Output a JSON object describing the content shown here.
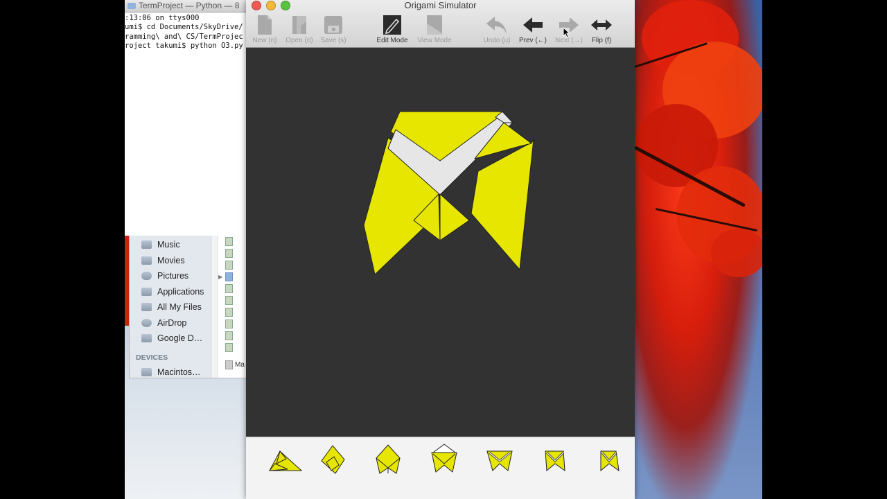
{
  "terminal": {
    "title": "TermProject — Python — 8",
    "lines": [
      ":13:06 on ttys000",
      "umi$ cd Documents/SkyDrive/",
      "ramming\\ and\\ CS/TermProjec",
      "roject takumi$ python O3.py"
    ]
  },
  "finder": {
    "items": [
      {
        "label": "Music",
        "icon": "folder-icon"
      },
      {
        "label": "Movies",
        "icon": "movies-icon"
      },
      {
        "label": "Pictures",
        "icon": "camera-icon"
      },
      {
        "label": "Applications",
        "icon": "folder-icon"
      },
      {
        "label": "All My Files",
        "icon": "files-icon"
      },
      {
        "label": "AirDrop",
        "icon": "airdrop-icon"
      },
      {
        "label": "Google D…",
        "icon": "folder-icon"
      }
    ],
    "devices_header": "DEVICES",
    "devices": [
      {
        "label": "Macintos…",
        "icon": "disk-icon"
      }
    ],
    "file_stub": "Ma"
  },
  "window": {
    "title": "Origami Simulator",
    "traffic_lights": [
      "#ee5b52",
      "#f4b93b",
      "#59c43e"
    ],
    "toolbar": [
      {
        "id": "new",
        "label": "New (n)",
        "icon": "new-document-icon",
        "enabled": false
      },
      {
        "id": "open",
        "label": "Open (o)",
        "icon": "open-document-icon",
        "enabled": false
      },
      {
        "id": "save",
        "label": "Save (s)",
        "icon": "save-disk-icon",
        "enabled": false
      },
      {
        "id": "edit",
        "label": "Edit Mode",
        "icon": "pencil-icon",
        "enabled": true
      },
      {
        "id": "view",
        "label": "View Mode",
        "icon": "page-icon",
        "enabled": false
      },
      {
        "id": "undo",
        "label": "Undo (u)",
        "icon": "undo-arrow-icon",
        "enabled": false
      },
      {
        "id": "prev",
        "label": "Prev (←)",
        "icon": "left-arrow-icon",
        "enabled": true
      },
      {
        "id": "next",
        "label": "Next (→)",
        "icon": "right-arrow-icon",
        "enabled": false
      },
      {
        "id": "flip",
        "label": "Flip (f)",
        "icon": "double-arrow-icon",
        "enabled": true
      }
    ],
    "thumbnails": [
      "step-1",
      "step-2",
      "step-3",
      "step-4",
      "step-5",
      "step-6",
      "step-7"
    ],
    "colors": {
      "paper": "#e6e600",
      "paper_back": "#e6e6e6",
      "canvas": "#323232",
      "edge": "#222222"
    }
  }
}
